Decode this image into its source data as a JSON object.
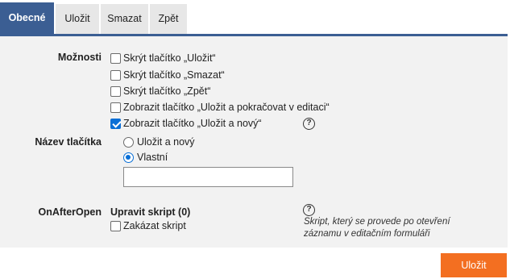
{
  "tabs": [
    {
      "label": "Obecné",
      "active": true
    },
    {
      "label": "Uložit",
      "active": false
    },
    {
      "label": "Smazat",
      "active": false
    },
    {
      "label": "Zpět",
      "active": false
    }
  ],
  "options_section": {
    "label": "Možnosti",
    "checkboxes": [
      {
        "label": "Skrýt tlačítko „Uložit“",
        "checked": false
      },
      {
        "label": "Skrýt tlačítko „Smazat“",
        "checked": false
      },
      {
        "label": "Skrýt tlačítko „Zpět“",
        "checked": false
      },
      {
        "label": "Zobrazit tlačítko „Uložit a pokračovat v editaci“",
        "checked": false
      },
      {
        "label": "Zobrazit tlačítko „Uložit a nový“",
        "checked": true
      }
    ],
    "help_glyph": "?"
  },
  "button_name_section": {
    "label": "Název tlačítka",
    "radios": [
      {
        "label": "Uložit a nový",
        "checked": false
      },
      {
        "label": "Vlastní",
        "checked": true
      }
    ],
    "custom_value": "",
    "custom_placeholder": ""
  },
  "on_after_open_section": {
    "label": "OnAfterOpen",
    "edit_script_label": "Upravit skript (0)",
    "disable_script_label": "Zakázat skript",
    "disable_script_checked": false,
    "help_glyph": "?",
    "help_text_line1": "Skript, který se provede po otevření",
    "help_text_line2": "záznamu v editačním formuláři"
  },
  "footer": {
    "save_label": "Uložit"
  },
  "colors": {
    "accent": "#3b5e93",
    "save_button": "#f36f21",
    "checkbox": "#0a6fd6",
    "panel_bg": "#f2f2f2"
  }
}
